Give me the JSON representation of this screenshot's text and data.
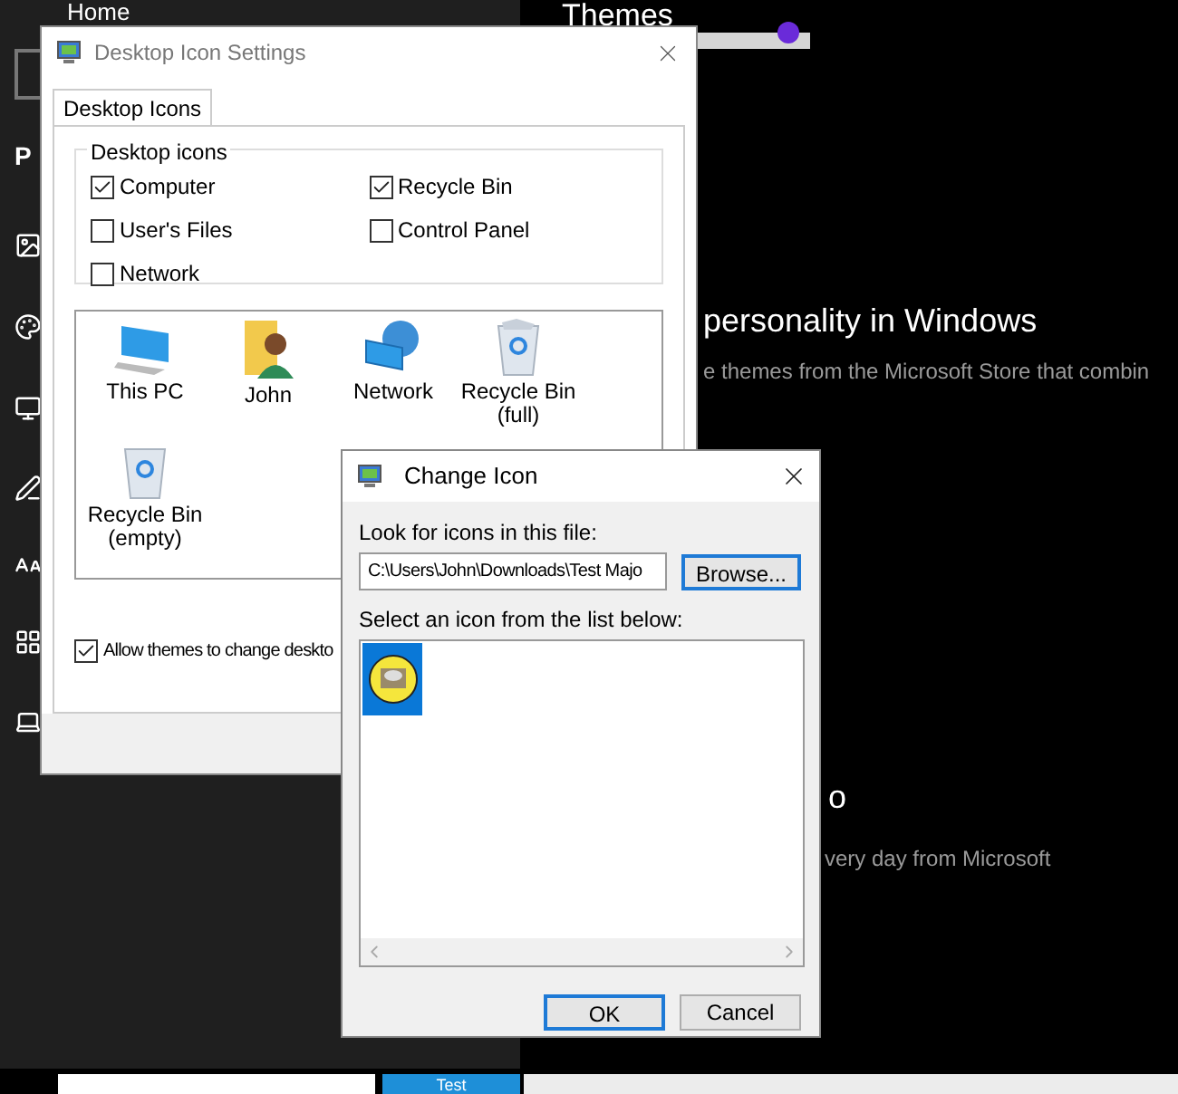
{
  "settings_window": {
    "nav_title": "Home",
    "section_label": "P",
    "page_title": "Themes",
    "texts": [
      {
        "kind": "heading",
        "text": "personality in Windows"
      },
      {
        "kind": "body",
        "text": "e themes from the Microsoft Store that combin"
      },
      {
        "kind": "heading",
        "text": "o"
      },
      {
        "kind": "body",
        "text": "very day from Microsoft"
      }
    ]
  },
  "desktop_icon_settings": {
    "title": "Desktop Icon Settings",
    "tabs": [
      {
        "label": "Desktop Icons",
        "selected": true
      }
    ],
    "group_label": "Desktop icons",
    "checkboxes": [
      {
        "label": "Computer",
        "checked": true
      },
      {
        "label": "Recycle Bin",
        "checked": true
      },
      {
        "label": "User's Files",
        "checked": false
      },
      {
        "label": "Control Panel",
        "checked": false
      },
      {
        "label": "Network",
        "checked": false
      }
    ],
    "icons": [
      {
        "kind": "pc",
        "label": "This PC"
      },
      {
        "kind": "user",
        "label": "John"
      },
      {
        "kind": "network",
        "label": "Network"
      },
      {
        "kind": "bin-full",
        "label": "Recycle Bin (full)"
      },
      {
        "kind": "bin-empty",
        "label": "Recycle Bin (empty)"
      }
    ],
    "allow_themes": {
      "label": "Allow themes to change deskto",
      "checked": true
    }
  },
  "change_icon": {
    "title": "Change Icon",
    "file_label": "Look for icons in this file:",
    "file_value": "C:\\Users\\John\\Downloads\\Test Majo",
    "browse": "Browse...",
    "list_label": "Select an icon from the list below:",
    "icons": [
      {
        "kind": "picture",
        "selected": true
      }
    ],
    "buttons": [
      {
        "label": "OK",
        "default": true
      },
      {
        "label": "Cancel",
        "default": false
      }
    ]
  },
  "taskbar": {
    "tile_label": "Test"
  }
}
